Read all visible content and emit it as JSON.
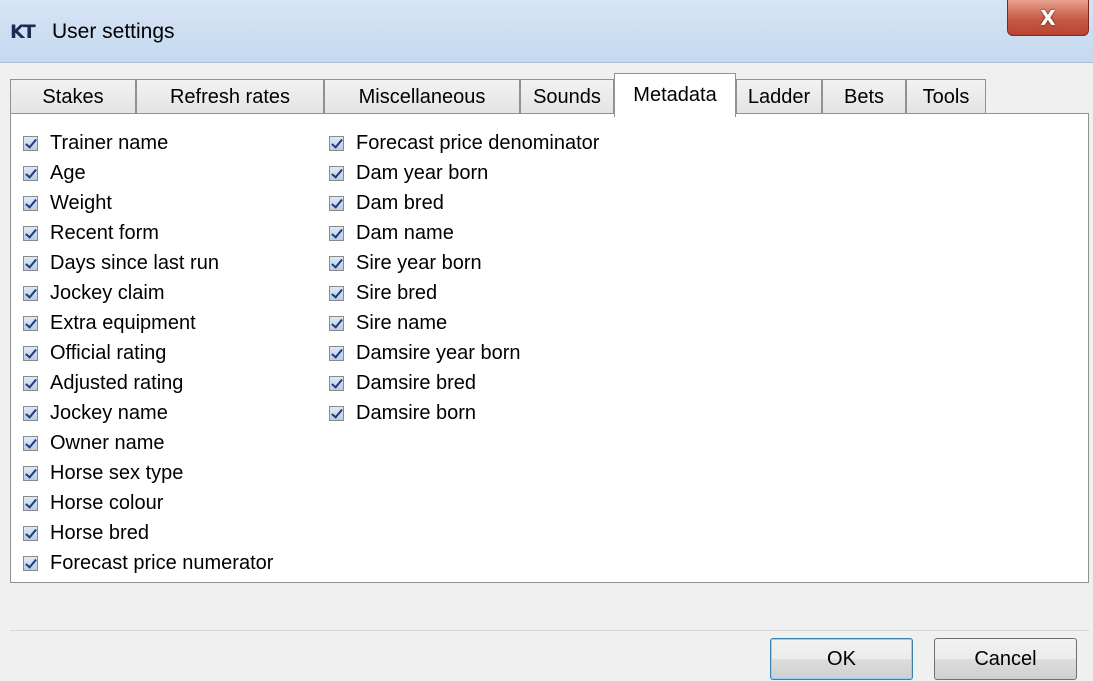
{
  "window": {
    "title": "User settings",
    "app_icon_text": "KT",
    "close_glyph": "X"
  },
  "tabs": [
    {
      "label": "Stakes"
    },
    {
      "label": "Refresh rates"
    },
    {
      "label": "Miscellaneous"
    },
    {
      "label": "Sounds"
    },
    {
      "label": "Metadata"
    },
    {
      "label": "Ladder"
    },
    {
      "label": "Bets"
    },
    {
      "label": "Tools"
    }
  ],
  "active_tab": "Metadata",
  "metadata": {
    "column1": [
      {
        "label": "Trainer name",
        "checked": true
      },
      {
        "label": "Age",
        "checked": true
      },
      {
        "label": "Weight",
        "checked": true
      },
      {
        "label": "Recent form",
        "checked": true
      },
      {
        "label": "Days since last run",
        "checked": true
      },
      {
        "label": "Jockey claim",
        "checked": true
      },
      {
        "label": "Extra equipment",
        "checked": true
      },
      {
        "label": "Official rating",
        "checked": true
      },
      {
        "label": "Adjusted rating",
        "checked": true
      },
      {
        "label": "Jockey name",
        "checked": true
      },
      {
        "label": "Owner name",
        "checked": true
      },
      {
        "label": "Horse sex type",
        "checked": true
      },
      {
        "label": "Horse colour",
        "checked": true
      },
      {
        "label": "Horse bred",
        "checked": true
      },
      {
        "label": "Forecast price numerator",
        "checked": true
      }
    ],
    "column2": [
      {
        "label": "Forecast price denominator",
        "checked": true
      },
      {
        "label": "Dam year born",
        "checked": true
      },
      {
        "label": "Dam bred",
        "checked": true
      },
      {
        "label": "Dam name",
        "checked": true
      },
      {
        "label": "Sire year born",
        "checked": true
      },
      {
        "label": "Sire bred",
        "checked": true
      },
      {
        "label": "Sire name",
        "checked": true
      },
      {
        "label": "Damsire year born",
        "checked": true
      },
      {
        "label": "Damsire bred",
        "checked": true
      },
      {
        "label": "Damsire born",
        "checked": true
      }
    ]
  },
  "buttons": {
    "ok_label": "OK",
    "cancel_label": "Cancel"
  }
}
